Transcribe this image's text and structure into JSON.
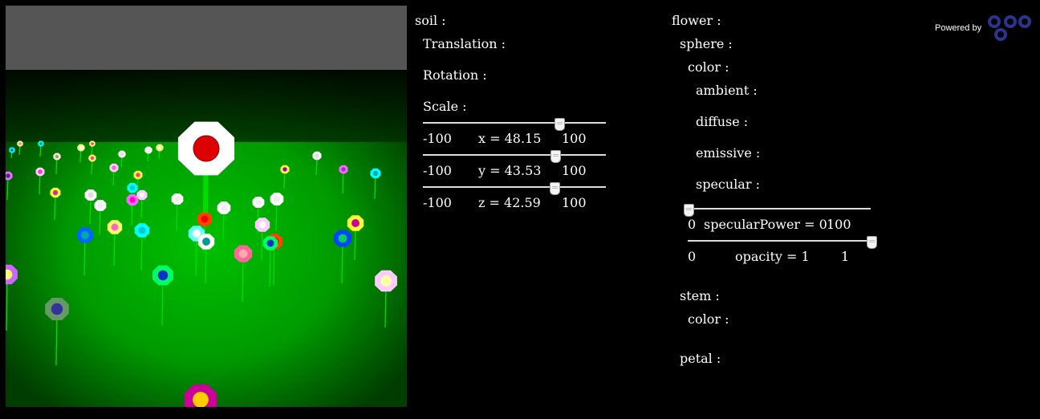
{
  "colors": {
    "background": "#000000",
    "toolbar": "#555555",
    "grass": "#00b000",
    "accent": "#2a3a9a"
  },
  "left_panel": {
    "soil_label": "soil :",
    "translation_label": "Translation :",
    "rotation_label": "Rotation :",
    "scale_label": "Scale :",
    "sliders": [
      {
        "axis": "x",
        "label": "x = 48.15",
        "min": "-100",
        "max": "100",
        "value": 48.15
      },
      {
        "axis": "y",
        "label": "y = 43.53",
        "min": "-100",
        "max": "100",
        "value": 43.53
      },
      {
        "axis": "z",
        "label": "z = 42.59",
        "min": "-100",
        "max": "100",
        "value": 42.59
      }
    ]
  },
  "right_panel": {
    "flower_label": "flower :",
    "sphere_label": "sphere :",
    "color_label": "color :",
    "ambient_label": "ambient :",
    "diffuse_label": "diffuse :",
    "emissive_label": "emissive :",
    "specular_label": "specular :",
    "specular_power": {
      "label": "specularPower = 0",
      "min": "0",
      "max": "100",
      "value": 0
    },
    "opacity": {
      "label": "opacity = 1",
      "min": "0",
      "max": "1",
      "value": 1
    },
    "stem_label": "stem :",
    "stem_color_label": "color :",
    "petal_label": "petal :"
  },
  "branding": {
    "powered_by": "Powered by",
    "logo_icon": "goo-logo-icon"
  }
}
